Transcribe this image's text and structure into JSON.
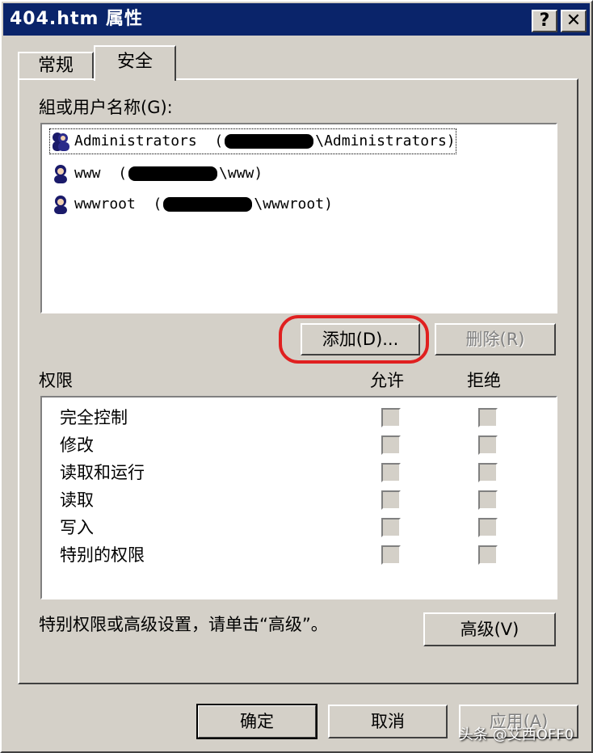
{
  "window": {
    "title": "404.htm 属性",
    "help_button": "?",
    "close_button": "✕"
  },
  "tabs": [
    {
      "label": "常规",
      "active": false
    },
    {
      "label": "安全",
      "active": true
    }
  ],
  "users_section": {
    "label": "組或用户名称(G):",
    "items": [
      {
        "name": "Administrators",
        "suffix": "\\Administrators)"
      },
      {
        "name": "www",
        "suffix": "\\www)"
      },
      {
        "name": "wwwroot",
        "suffix": "\\wwwroot)"
      }
    ],
    "add_button": "添加(D)...",
    "remove_button": "删除(R)"
  },
  "permissions_section": {
    "label": "权限",
    "allow_header": "允许",
    "deny_header": "拒绝",
    "rows": [
      {
        "label": "完全控制",
        "allow": false,
        "deny": false
      },
      {
        "label": "修改",
        "allow": false,
        "deny": false
      },
      {
        "label": "读取和运行",
        "allow": false,
        "deny": false
      },
      {
        "label": "读取",
        "allow": false,
        "deny": false
      },
      {
        "label": "写入",
        "allow": false,
        "deny": false
      },
      {
        "label": "特别的权限",
        "allow": false,
        "deny": false
      }
    ]
  },
  "advanced": {
    "hint": "特别权限或高级设置，请单击“高级”。",
    "button": "高级(V)"
  },
  "footer": {
    "ok": "确定",
    "cancel": "取消",
    "apply": "应用(A)"
  },
  "watermark": "头条 @艾西OFF0",
  "colors": {
    "face": "#d4d0c8",
    "titlebar": "#0a246a",
    "highlight_ring": "#e02020"
  }
}
